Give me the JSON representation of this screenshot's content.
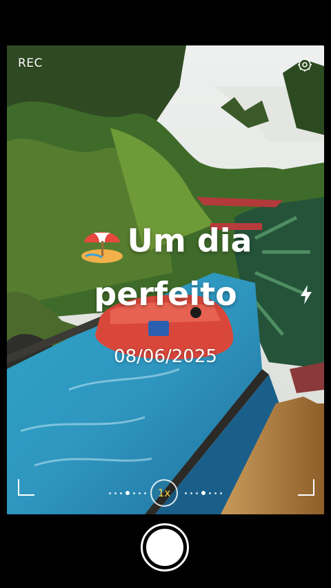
{
  "status": {
    "rec_label": "REC"
  },
  "overlay": {
    "headline_line1": "Um dia",
    "headline_line2": "perfeito",
    "emoji": "🏖️",
    "date": "08/06/2025"
  },
  "camera": {
    "zoom_label": "1x",
    "accent_color": "#f4d34a"
  },
  "icons": {
    "settings": "settings-icon",
    "flash": "flash-icon",
    "umbrella": "beach-umbrella-icon"
  }
}
